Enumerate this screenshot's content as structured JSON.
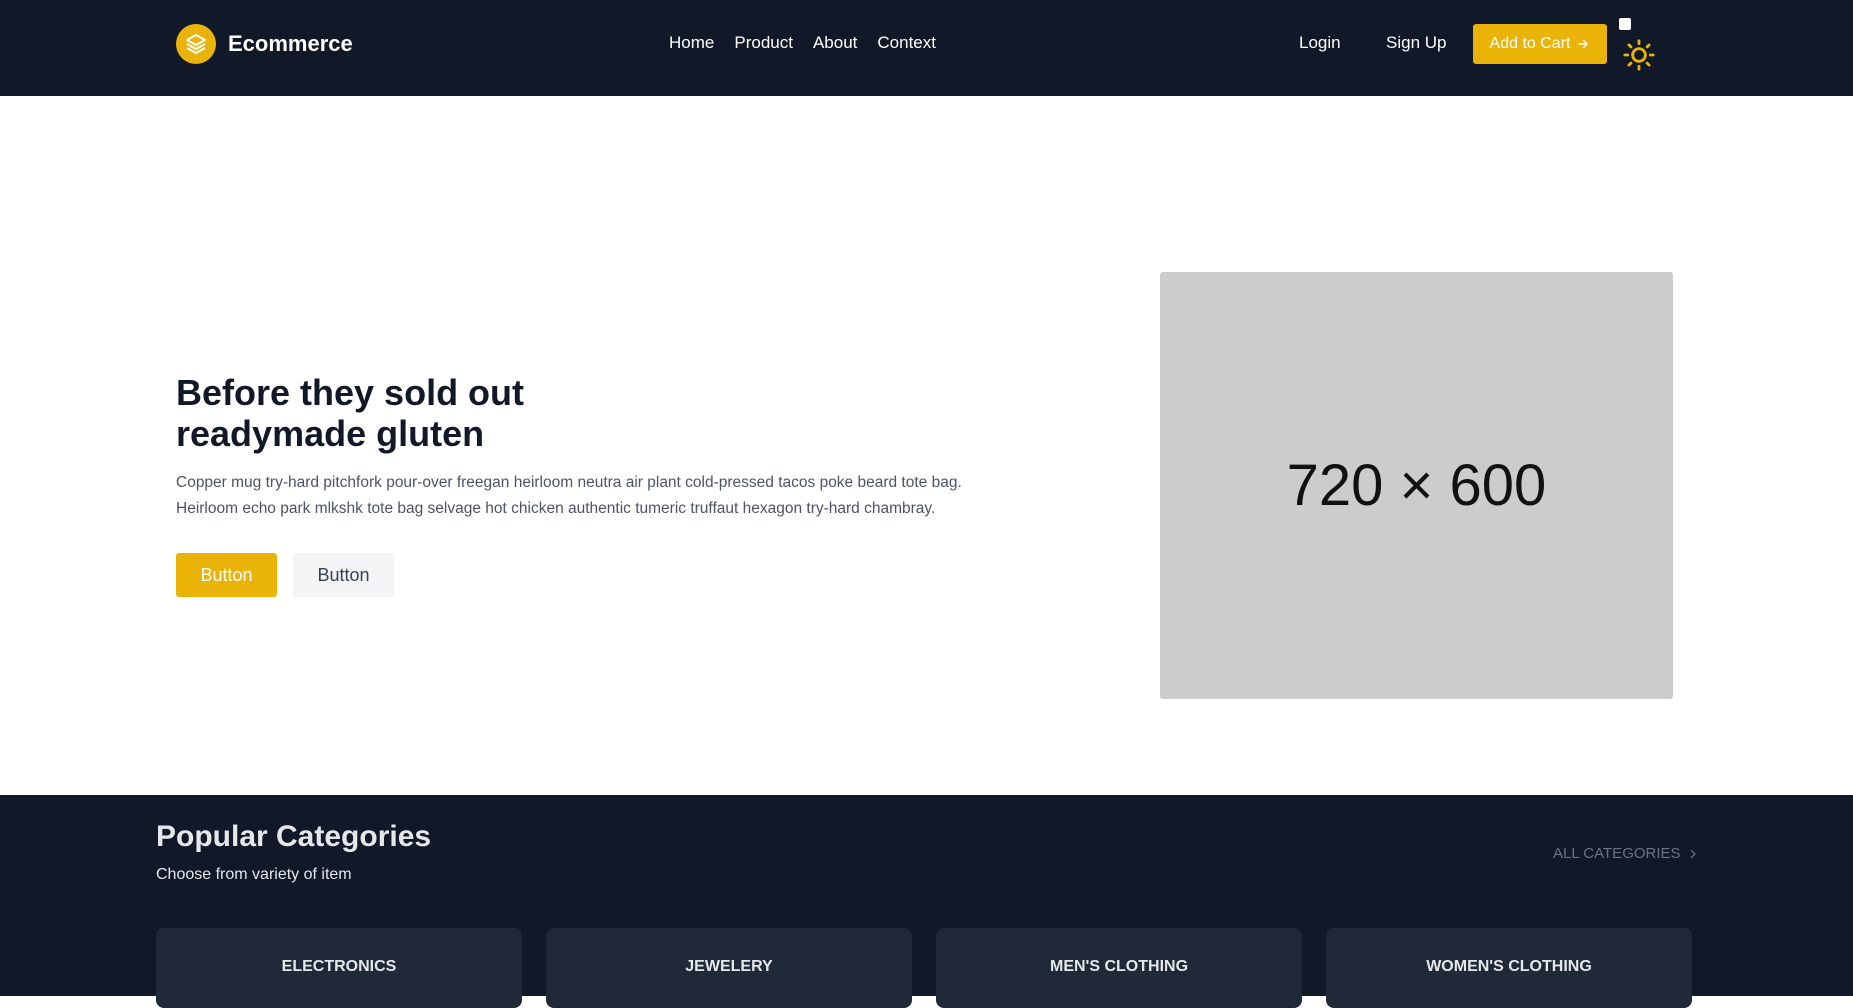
{
  "header": {
    "brand": "Ecommerce",
    "nav": [
      "Home",
      "Product",
      "About",
      "Context"
    ],
    "login_label": "Login",
    "signup_label": "Sign Up",
    "cart_label": "Add to Cart",
    "accent_color": "#eab308",
    "background_color": "#111827"
  },
  "hero": {
    "title_line1": "Before they sold out",
    "title_line2": "readymade gluten",
    "description_line1": "Copper mug try-hard pitchfork pour-over freegan heirloom neutra air plant cold-pressed tacos poke beard tote bag.",
    "description_line2": "Heirloom echo park mlkshk tote bag selvage hot chicken authentic tumeric truffaut hexagon try-hard chambray.",
    "primary_button": "Button",
    "secondary_button": "Button",
    "image_label": "720 × 600"
  },
  "categories": {
    "title": "Popular Categories",
    "subtitle": "Choose from variety of item",
    "all_label": "ALL CATEGORIES",
    "items": [
      "ELECTRONICS",
      "JEWELERY",
      "MEN'S CLOTHING",
      "WOMEN'S CLOTHING"
    ]
  },
  "icons": {
    "logo": "stack-layers-icon",
    "cart_arrow": "arrow-right-icon",
    "theme": "sun-icon",
    "all_chevron": "chevron-right-icon"
  }
}
